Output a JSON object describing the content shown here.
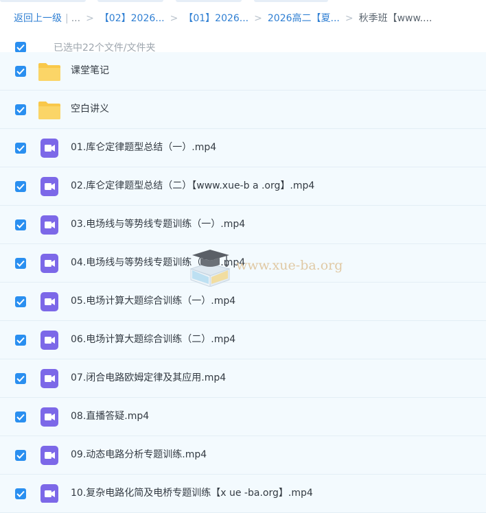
{
  "breadcrumb": {
    "back": "返回上一级",
    "ellipsis": "...",
    "crumbs": [
      "【02】2026...",
      "【01】2026...",
      "2026高二【夏..."
    ],
    "current": "秋季班【www...."
  },
  "selection": {
    "count_text": "已选中22个文件/文件夹"
  },
  "files": [
    {
      "name": "课堂笔记",
      "type": "folder-icon"
    },
    {
      "name": "空白讲义",
      "type": "folder-icon"
    },
    {
      "name": "01.库仑定律题型总结（一）.mp4",
      "type": "video-icon"
    },
    {
      "name": "02.库仑定律题型总结（二）【www.xue-b a .org】.mp4",
      "type": "video-icon"
    },
    {
      "name": "03.电场线与等势线专题训练（一）.mp4",
      "type": "video-icon"
    },
    {
      "name": "04.电场线与等势线专题训练（二）.mp4",
      "type": "video-icon"
    },
    {
      "name": "05.电场计算大题综合训练（一）.mp4",
      "type": "video-icon"
    },
    {
      "name": "06.电场计算大题综合训练（二）.mp4",
      "type": "video-icon"
    },
    {
      "name": "07.闭合电路欧姆定律及其应用.mp4",
      "type": "video-icon"
    },
    {
      "name": "08.直播答疑.mp4",
      "type": "video-icon"
    },
    {
      "name": "09.动态电路分析专题训练.mp4",
      "type": "video-icon"
    },
    {
      "name": "10.复杂电路化简及电桥专题训练【x ue -ba.org】.mp4",
      "type": "video-icon"
    }
  ],
  "watermark": {
    "text": "www.xue-ba.org"
  },
  "colors": {
    "accent": "#2a8ff0",
    "link": "#2f7fd3",
    "row_bg": "#f3fafe",
    "folder": "#f9c84a",
    "video": "#7c68e8"
  }
}
